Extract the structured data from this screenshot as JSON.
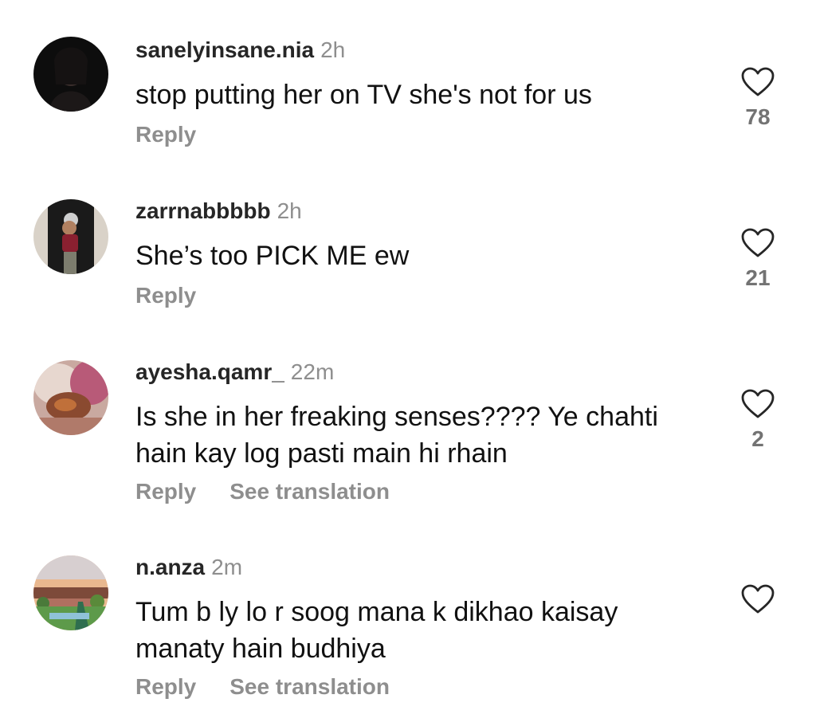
{
  "comments": [
    {
      "username": "sanelyinsane.nia",
      "time": "2h",
      "text": "stop putting her on TV she's not for us",
      "reply_label": "Reply",
      "likes": "78"
    },
    {
      "username": "zarrnabbbbb",
      "time": "2h",
      "text": "She’s too PICK ME ew",
      "reply_label": "Reply",
      "likes": "21"
    },
    {
      "username": "ayesha.qamr_",
      "time": "22m",
      "text": "Is she in her freaking senses???? Ye chahti hain kay log  pasti main hi rhain",
      "reply_label": "Reply",
      "translate_label": "See translation",
      "likes": "2"
    },
    {
      "username": "n.anza",
      "time": "2m",
      "text": "Tum b ly lo r soog mana k dikhao kaisay manaty hain budhiya",
      "reply_label": "Reply",
      "translate_label": "See translation"
    }
  ],
  "icons": {
    "like": "heart-outline-icon"
  },
  "colors": {
    "username": "#262626",
    "secondary": "#8e8e8e",
    "count": "#737373"
  }
}
